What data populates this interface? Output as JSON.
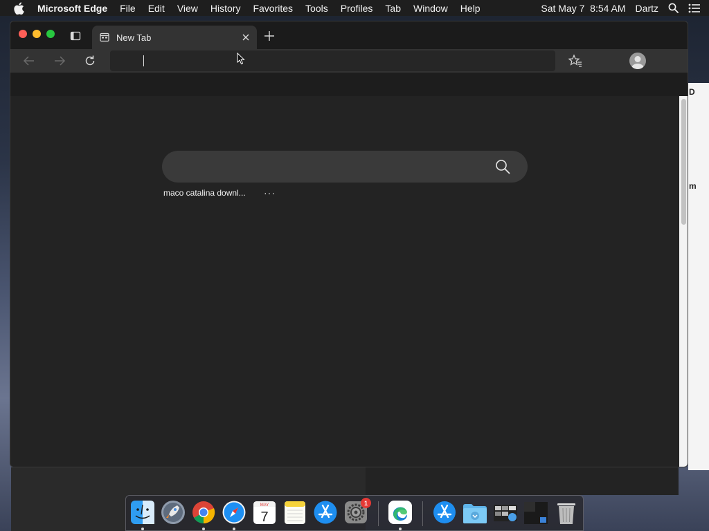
{
  "menubar": {
    "app_name": "Microsoft Edge",
    "menus": [
      "File",
      "Edit",
      "View",
      "History",
      "Favorites",
      "Tools",
      "Profiles",
      "Tab",
      "Window",
      "Help"
    ],
    "datetime": "Sat May 7  8:54 AM",
    "user": "Dartz"
  },
  "background_peek": {
    "text1": "D",
    "text2": "m"
  },
  "browser": {
    "tab": {
      "title": "New Tab"
    },
    "address_bar": {
      "value": ""
    },
    "search": {
      "value": "",
      "placeholder": ""
    },
    "suggestion": "maco catalina downl...",
    "more_label": "···",
    "colors": {
      "window_bg": "#202020",
      "toolbar_bg": "#333333",
      "search_bg": "#3a3a3a"
    }
  },
  "dock": {
    "items": [
      {
        "name": "Finder",
        "icon": "finder-icon",
        "running": true
      },
      {
        "name": "Launchpad",
        "icon": "launchpad-icon",
        "running": false
      },
      {
        "name": "Google Chrome",
        "icon": "chrome-icon",
        "running": true
      },
      {
        "name": "Safari",
        "icon": "safari-icon",
        "running": true
      },
      {
        "name": "Calendar",
        "icon": "calendar-icon",
        "running": false,
        "month": "MAY",
        "day": "7"
      },
      {
        "name": "Notes",
        "icon": "notes-icon",
        "running": false
      },
      {
        "name": "App Store",
        "icon": "app-store-icon",
        "running": false
      },
      {
        "name": "System Preferences",
        "icon": "system-preferences-icon",
        "running": false,
        "badge": "1"
      },
      {
        "name": "Microsoft Edge",
        "icon": "edge-icon",
        "running": true
      },
      {
        "name": "Applications",
        "icon": "applications-folder-icon",
        "running": false
      },
      {
        "name": "Downloads",
        "icon": "downloads-folder-icon",
        "running": false
      },
      {
        "name": "Screenshots",
        "icon": "screenshots-stack-icon",
        "running": false
      },
      {
        "name": "Documents",
        "icon": "documents-stack-icon",
        "running": false
      },
      {
        "name": "Trash",
        "icon": "trash-icon",
        "running": false
      }
    ]
  }
}
